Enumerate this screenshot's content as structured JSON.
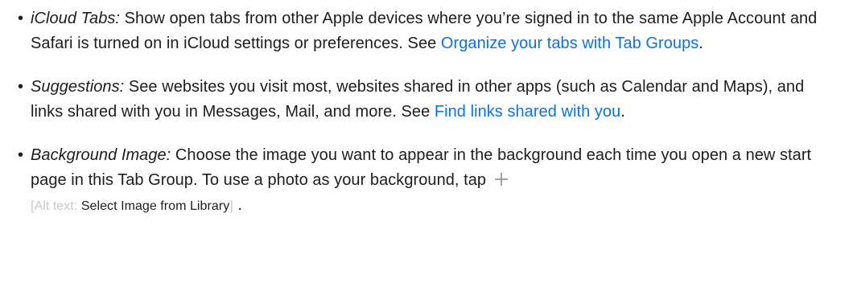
{
  "items": [
    {
      "term": "iCloud Tabs:",
      "text": " Show open tabs from other Apple devices where you’re signed in to the same Apple Account and Safari is turned on in iCloud settings or preferences. See ",
      "link": "Organize your tabs with Tab Groups",
      "end": "."
    },
    {
      "term": "Suggestions:",
      "text": " See websites you visit most, websites shared in other apps (such as Calendar and Maps), and links shared with you in Messages, Mail, and more. See ",
      "link": "Find links shared with you",
      "end": "."
    },
    {
      "term": "Background Image:",
      "text": " Choose the image you want to appear in the background each time you open a new start page in this Tab Group. To use a photo as your background, tap",
      "icon": "plus-icon",
      "alt_prefix": "Alt text:",
      "alt_value": "Select Image from Library",
      "open_bracket": "[",
      "close_bracket": "]",
      "end": "."
    }
  ],
  "colors": {
    "text": "#1d1d1f",
    "link": "#0b72e7",
    "muted": "#c7c9cc"
  }
}
